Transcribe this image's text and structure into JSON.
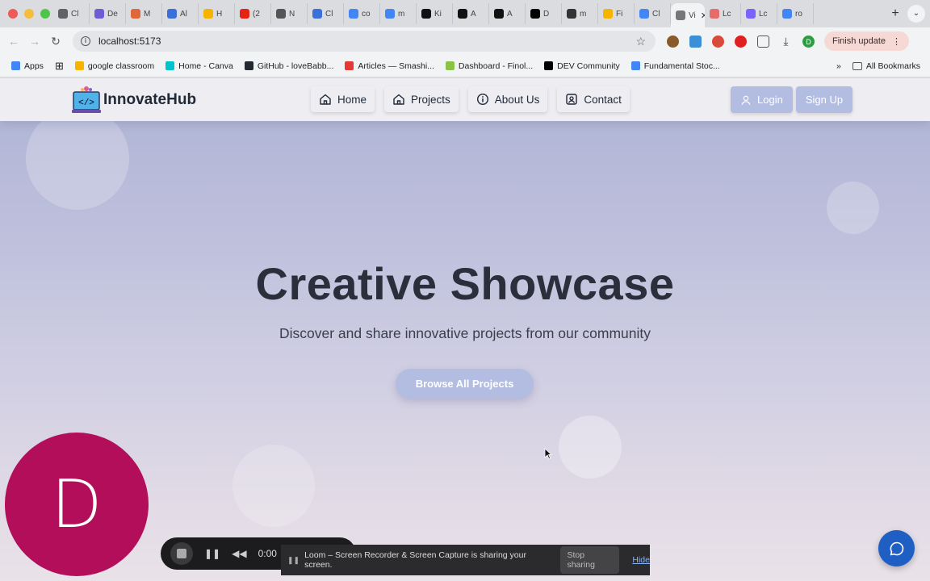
{
  "browser": {
    "tabs": [
      {
        "label": "Cl",
        "color": "#5f6368"
      },
      {
        "label": "De",
        "color": "#6f5bd6"
      },
      {
        "label": "M",
        "color": "#e0673a"
      },
      {
        "label": "Al",
        "color": "#3b6fd9"
      },
      {
        "label": "H",
        "color": "#f5b400"
      },
      {
        "label": "(2",
        "color": "#e62117"
      },
      {
        "label": "N",
        "color": "#555555"
      },
      {
        "label": "Cl",
        "color": "#3b6fd9"
      },
      {
        "label": "co",
        "color": "#4285f4"
      },
      {
        "label": "m",
        "color": "#4285f4"
      },
      {
        "label": "Ki",
        "color": "#111111"
      },
      {
        "label": "A",
        "color": "#111111"
      },
      {
        "label": "A",
        "color": "#111111"
      },
      {
        "label": "D",
        "color": "#000000"
      },
      {
        "label": "m",
        "color": "#333333"
      },
      {
        "label": "Fi",
        "color": "#f5b400"
      },
      {
        "label": "Cl",
        "color": "#4285f4"
      },
      {
        "label": "Vi",
        "color": "#777777",
        "active": true
      },
      {
        "label": "Lc",
        "color": "#e66b6b"
      },
      {
        "label": "Lc",
        "color": "#7b61ff"
      },
      {
        "label": "ro",
        "color": "#4285f4"
      }
    ],
    "new_tab": "+",
    "address": "localhost:5173",
    "finish_update": "Finish update",
    "profile_initial": "D",
    "bookmarks": [
      {
        "label": "Apps",
        "color": "#4285f4"
      },
      {
        "label": "google classroom",
        "color": "#f5b400"
      },
      {
        "label": "Home - Canva",
        "color": "#00c4cc"
      },
      {
        "label": "GitHub - loveBabb...",
        "color": "#24292f"
      },
      {
        "label": "Articles — Smashi...",
        "color": "#e53935"
      },
      {
        "label": "Dashboard - Finol...",
        "color": "#8bc34a"
      },
      {
        "label": "DEV Community",
        "color": "#000000"
      },
      {
        "label": "Fundamental Stoc...",
        "color": "#4285f4"
      }
    ],
    "all_bookmarks": "All Bookmarks"
  },
  "site": {
    "brand": "InnovateHub",
    "nav": {
      "home": "Home",
      "projects": "Projects",
      "about": "About Us",
      "contact": "Contact"
    },
    "auth": {
      "login": "Login",
      "signup": "Sign Up"
    },
    "hero": {
      "title": "Creative Showcase",
      "subtitle": "Discover and share innovative projects from our community",
      "cta": "Browse All Projects"
    }
  },
  "overlays": {
    "avatar_initial": "D",
    "recorder_time": "0:00",
    "share_notice": "Loom – Screen Recorder & Screen Capture is sharing your screen.",
    "stop_sharing": "Stop sharing",
    "hide": "Hide"
  },
  "colors": {
    "accent_button": "#b3bde2",
    "avatar_bg": "#b30e5a",
    "chat_button": "#1f5fc4"
  }
}
